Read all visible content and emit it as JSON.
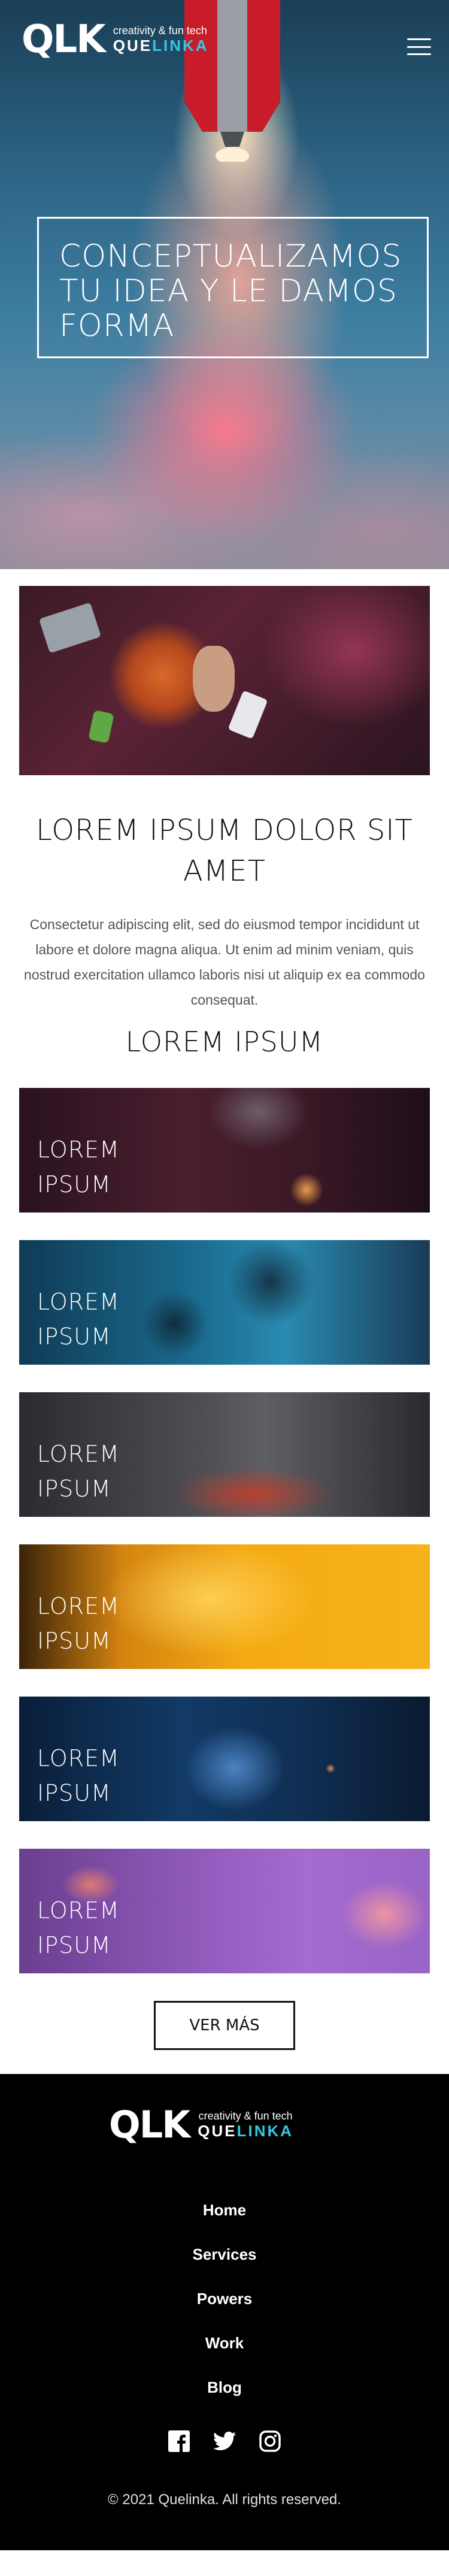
{
  "header": {
    "logo_mark": "QLK",
    "logo_tagline": "creativity & fun tech",
    "logo_brand_prefix": "QUE",
    "logo_brand_accent": "LINKA",
    "menu_icon": "hamburger-icon"
  },
  "hero": {
    "title": "CONCEPTUALIZAMOS TU IDEA Y LE DAMOS FORMA"
  },
  "intro": {
    "title": "LOREM IPSUM DOLOR SIT AMET",
    "body": "Consectetur adipiscing elit, sed do eiusmod tempor incididunt ut labore et dolore magna aliqua. Ut enim ad minim veniam, quis nostrud exercitation ullamco laboris nisi ut aliquip ex ea commodo consequat.",
    "subtitle": "LOREM IPSUM"
  },
  "cards": [
    {
      "label": "LOREM\nIPSUM"
    },
    {
      "label": "LOREM\nIPSUM"
    },
    {
      "label": "LOREM\nIPSUM"
    },
    {
      "label": "LOREM\nIPSUM"
    },
    {
      "label": "LOREM\nIPSUM"
    },
    {
      "label": "LOREM\nIPSUM"
    }
  ],
  "more_button": "VER MÁS",
  "footer": {
    "logo_mark": "QLK",
    "logo_tagline": "creativity & fun tech",
    "logo_brand_prefix": "QUE",
    "logo_brand_accent": "LINKA",
    "nav": [
      "Home",
      "Services",
      "Powers",
      "Work",
      "Blog"
    ],
    "social_icons": [
      "facebook-icon",
      "twitter-icon",
      "instagram-icon"
    ],
    "copyright": "© 2021 Quelinka. All rights reserved."
  },
  "colors": {
    "accent": "#35c7e0",
    "footer_bg": "#000000"
  }
}
